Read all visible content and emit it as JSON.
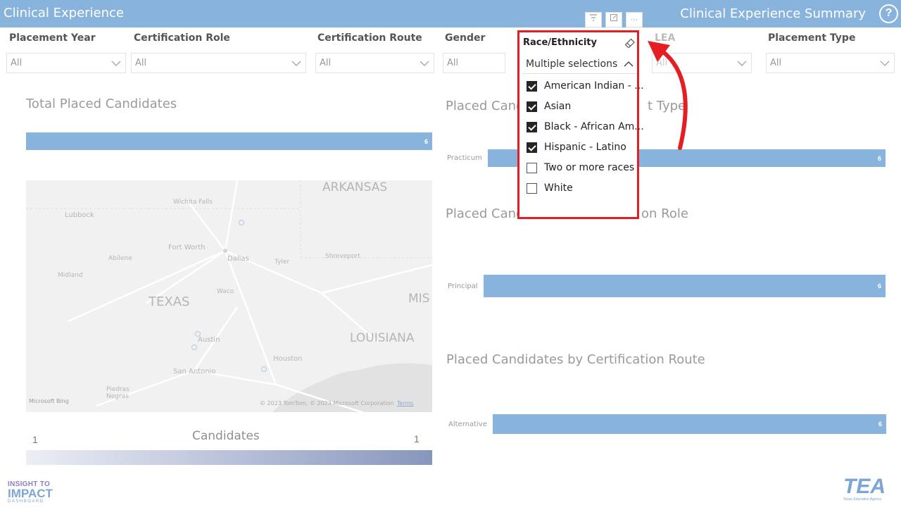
{
  "header": {
    "title": "Clinical Experience",
    "summary_title": "Clinical Experience Summary",
    "help_icon": "?"
  },
  "visual_header": {
    "filter_icon": "filter-icon",
    "focus_icon": "focus-mode-icon",
    "more_label": "···"
  },
  "filters": [
    {
      "label": "Placement Year",
      "value": "All"
    },
    {
      "label": "Certification Role",
      "value": "All"
    },
    {
      "label": "Certification Route",
      "value": "All"
    },
    {
      "label": "Gender",
      "value": "All"
    },
    {
      "label": "LEA",
      "value": "All"
    },
    {
      "label": "Placement Type",
      "value": "All"
    }
  ],
  "race_filter": {
    "label": "Race/Ethnicity",
    "selected_text": "Multiple selections",
    "options": [
      {
        "label": "American Indian - ...",
        "checked": true
      },
      {
        "label": "Asian",
        "checked": true
      },
      {
        "label": "Black - African Am...",
        "checked": true
      },
      {
        "label": "Hispanic - Latino",
        "checked": true
      },
      {
        "label": "Two or more races",
        "checked": false
      },
      {
        "label": "White",
        "checked": false
      }
    ]
  },
  "total_placed": {
    "title": "Total Placed Candidates",
    "value": "6"
  },
  "map": {
    "labels": {
      "arkansas": "ARKANSAS",
      "lubbock": "Lubbock",
      "wichita_falls": "Wichita Falls",
      "fort_worth": "Fort Worth",
      "dallas": "Dallas",
      "abilene": "Abilene",
      "tyler": "Tyler",
      "shreveport": "Shreveport",
      "midland": "Midland",
      "waco": "Waco",
      "texas": "TEXAS",
      "mis": "MIS",
      "louisiana": "LOUISIANA",
      "austin": "Austin",
      "houston": "Houston",
      "san_antonio": "San Antonio",
      "piedras_negras": "Piedras\nNegras",
      "bing": "Microsoft Bing",
      "copyright": "© 2023 TomTom, © 2023 Microsoft Corporation",
      "terms": "Terms"
    }
  },
  "legend": {
    "title": "Candidates",
    "min": "1",
    "max": "1"
  },
  "placement_type_chart": {
    "title_left": "Placed Cand",
    "title_right": "t Type",
    "category": "Practicum",
    "value": "6"
  },
  "role_chart": {
    "title_left": "Placed Cand",
    "title_right": "on Role",
    "category": "Principal",
    "value": "6"
  },
  "route_chart": {
    "title": "Placed Candidates by Certification Route",
    "category": "Alternative",
    "value": "6"
  },
  "logos": {
    "left_line1": "INSIGHT TO",
    "left_line2": "IMPACT",
    "left_line3": "DASHBOARD",
    "right_main": "TEA",
    "right_sub": "Texas Education Agency"
  },
  "colors": {
    "header": "#87b3dc",
    "bar": "#87b3dc",
    "highlight": "#e41e22"
  }
}
